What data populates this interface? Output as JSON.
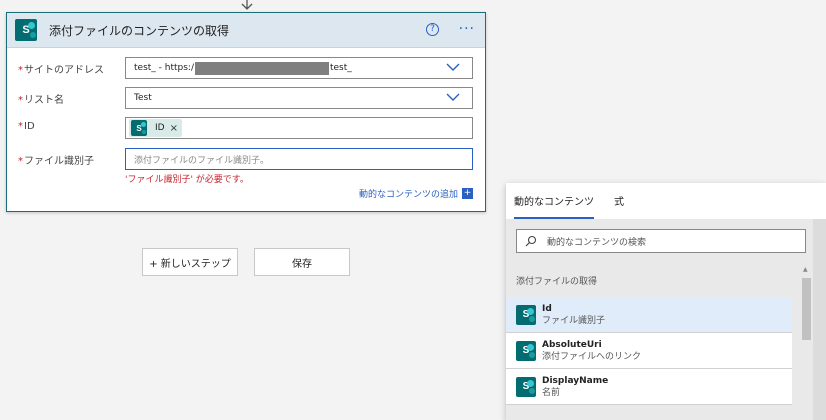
{
  "card": {
    "title": "添付ファイルのコンテンツの取得",
    "help_glyph": "?",
    "more_glyph": "···",
    "fields": [
      {
        "required": "*",
        "label": "サイトのアドレス",
        "value_prefix": "test_ - https:/",
        "value_suffix": "test_"
      },
      {
        "required": "*",
        "label": "リスト名",
        "value": "Test"
      },
      {
        "required": "*",
        "label": "ID",
        "token": "ID",
        "token_remove": "×"
      },
      {
        "required": "*",
        "label": "ファイル識別子",
        "placeholder": "添付ファイルのファイル識別子。"
      }
    ],
    "error": "'ファイル識別子' が必要です。",
    "add_dynamic": "動的なコンテンツの追加",
    "add_dynamic_plus": "+"
  },
  "buttons": {
    "new_step": "+ 新しいステップ",
    "save": "保存"
  },
  "dynamic_panel": {
    "tabs": [
      "動的なコンテンツ",
      "式"
    ],
    "search_placeholder": "動的なコンテンツの検索",
    "group_header": "添付ファイルの取得",
    "items": [
      {
        "name": "Id",
        "desc": "ファイル識別子"
      },
      {
        "name": "AbsoluteUri",
        "desc": "添付ファイルへのリンク"
      },
      {
        "name": "DisplayName",
        "desc": "名前"
      }
    ],
    "next_group_header": "",
    "scroll_up_glyph": "▲"
  },
  "icon_letter": "S",
  "colors": {
    "accent": "#2a5fc4",
    "sharepoint": "#036c70",
    "error": "#c4262e"
  }
}
